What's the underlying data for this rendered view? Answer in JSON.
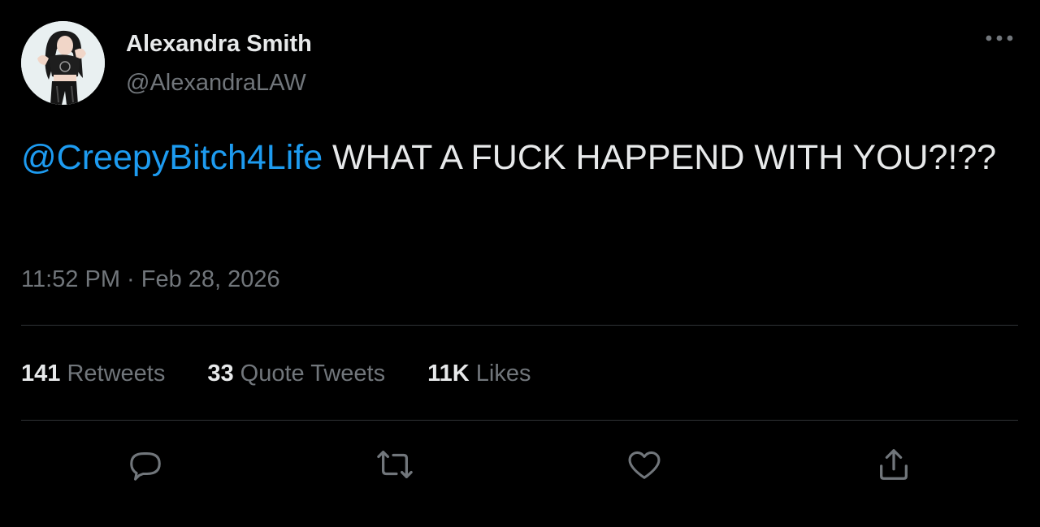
{
  "author": {
    "display_name": "Alexandra Smith",
    "handle": "@AlexandraLAW",
    "avatar_icon": "profile-photo"
  },
  "tweet": {
    "mention": "@CreepyBitch4Life",
    "body": " WHAT A FUCK HAPPEND WITH YOU?!??",
    "time": "11:52 PM",
    "separator": " · ",
    "date": "Feb 28, 2026"
  },
  "stats": {
    "retweets_count": "141",
    "retweets_label": " Retweets",
    "quotes_count": "33",
    "quotes_label": " Quote Tweets",
    "likes_count": "11K",
    "likes_label": " Likes"
  },
  "icons": {
    "more": "more-horizontal-icon",
    "reply": "reply-icon",
    "retweet": "retweet-icon",
    "like": "heart-icon",
    "share": "share-icon"
  },
  "colors": {
    "background": "#000000",
    "text": "#e7e9ea",
    "secondary": "#71767b",
    "accent": "#1d9bf0",
    "divider": "#2f3336"
  }
}
